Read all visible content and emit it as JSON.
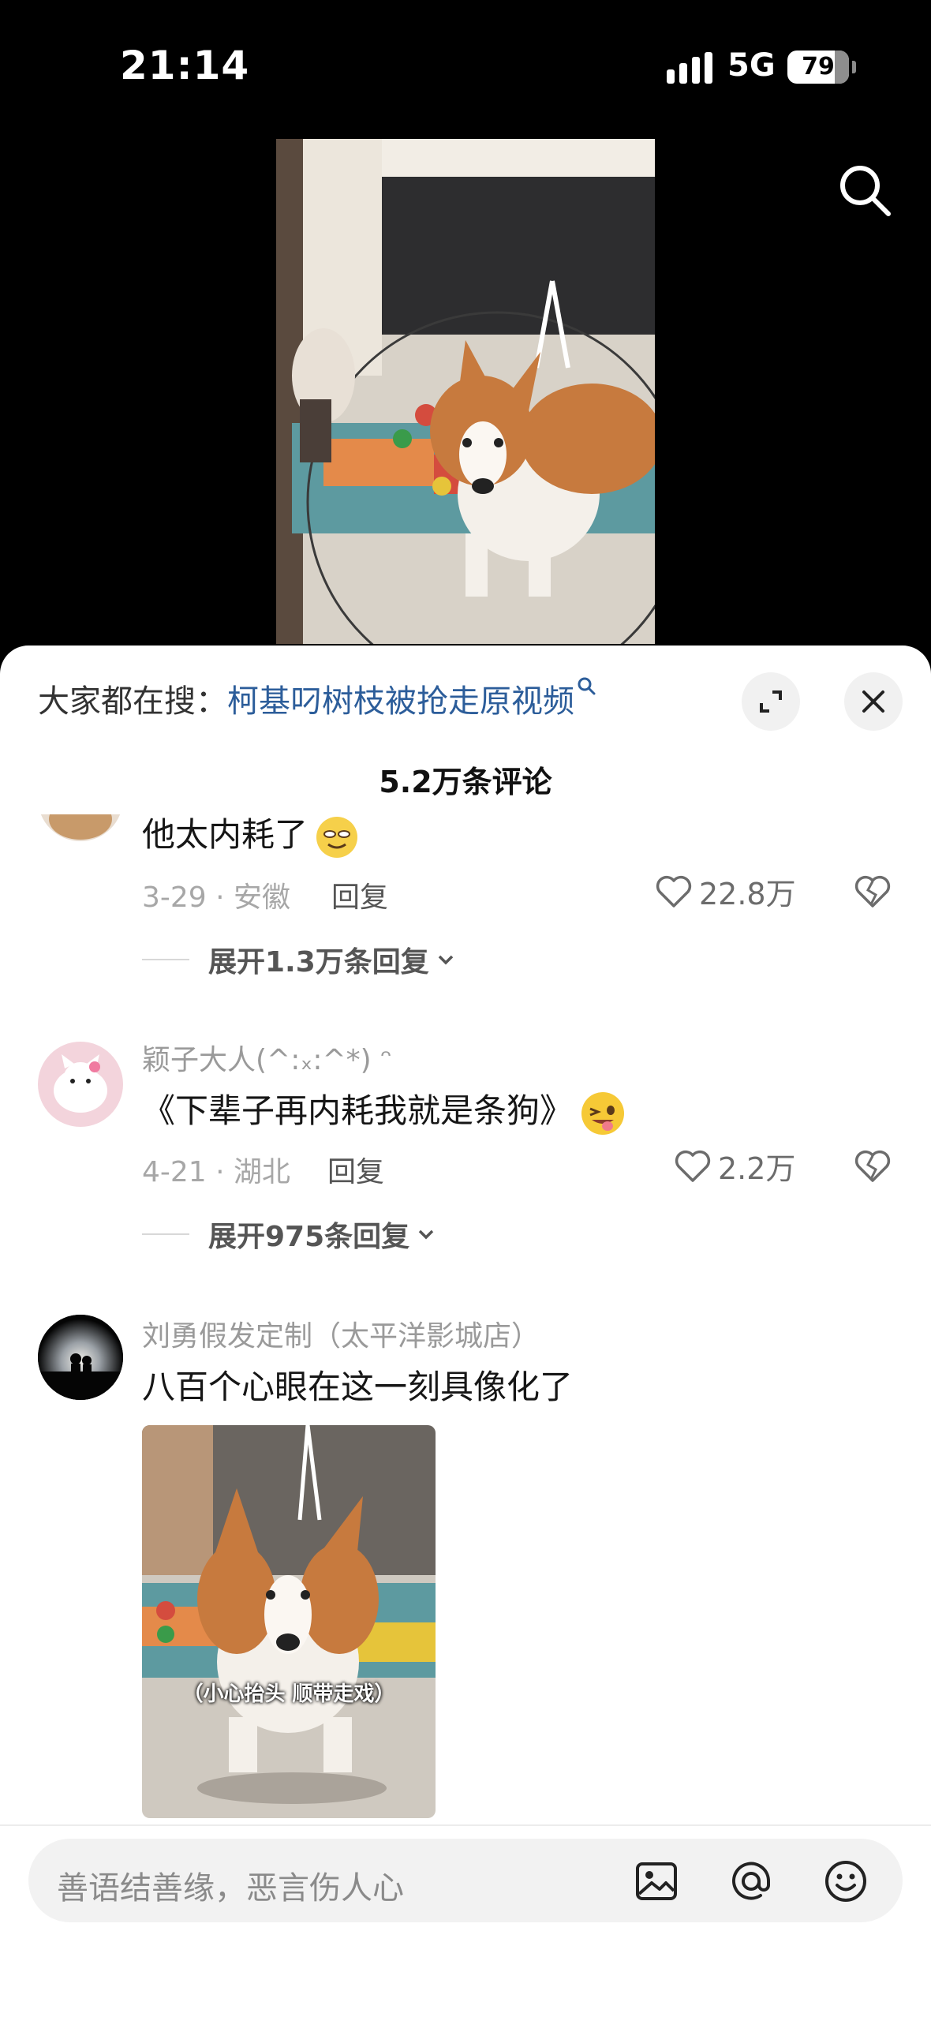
{
  "status_bar": {
    "time": "21:14",
    "network": "5G",
    "battery": "79"
  },
  "icons": {
    "top_search": "search-icon",
    "expand": "expand-icon",
    "close": "close-icon",
    "like": "heart-icon",
    "dislike": "broken-heart-icon",
    "image": "image-icon",
    "mention": "at-icon",
    "emoji": "smiley-icon"
  },
  "sheet": {
    "hot_search_prefix": "大家都在搜：",
    "hot_search_query": "柯基叼树枝被抢走原视频",
    "comment_count": "5.2万条评论"
  },
  "comments": [
    {
      "text": "他太内耗了",
      "date": "3-29",
      "location": "安徽",
      "reply_label": "回复",
      "likes": "22.8万",
      "expand_label": "展开1.3万条回复"
    },
    {
      "username": "颖子大人(^:ₓ:^*) ᵔ",
      "text": "《下辈子再内耗我就是条狗》",
      "date": "4-21",
      "location": "湖北",
      "reply_label": "回复",
      "likes": "2.2万",
      "expand_label": "展开975条回复"
    },
    {
      "username": "刘勇假发定制（太平洋影城店）",
      "text": "八百个心眼在这一刻具像化了",
      "image_caption": "（小心抬头 顺带走戏）"
    }
  ],
  "input": {
    "placeholder": "善语结善缘，恶言伤人心"
  },
  "colors": {
    "link": "#2c5d9a",
    "sheet_bg": "#ffffff",
    "input_bg": "#f2f2f2"
  }
}
